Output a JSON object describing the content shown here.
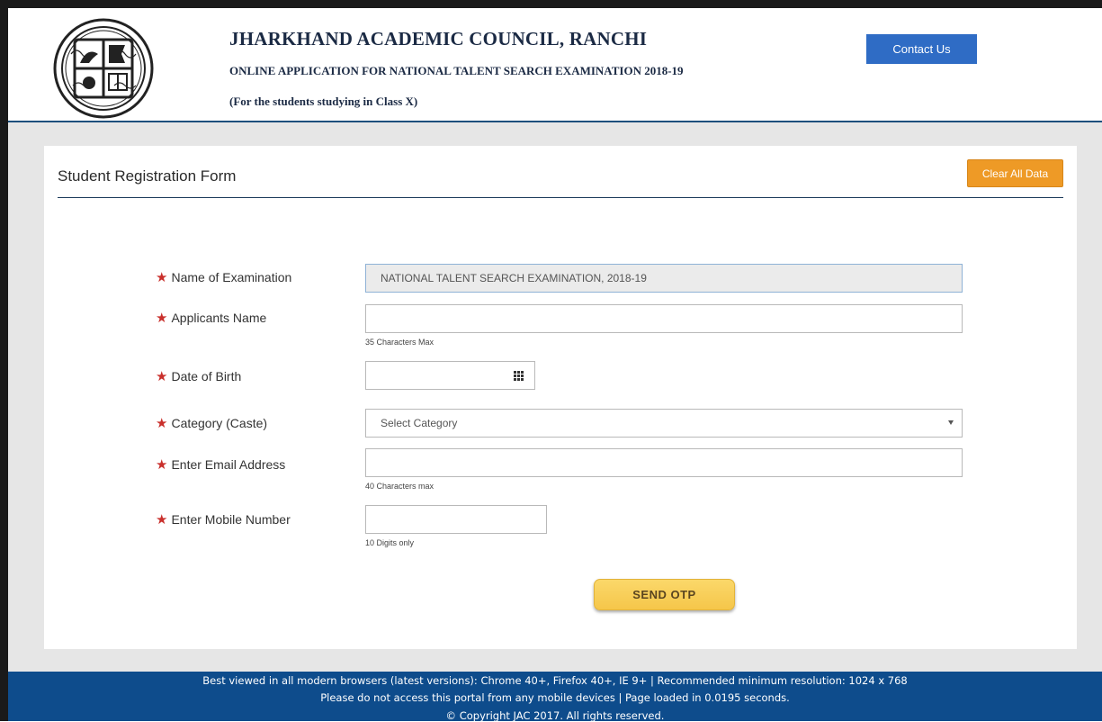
{
  "header": {
    "title": "JHARKHAND ACADEMIC COUNCIL, RANCHI",
    "subtitle": "ONLINE APPLICATION FOR NATIONAL TALENT SEARCH EXAMINATION 2018-19",
    "subtitle2": "(For the students studying in Class X)",
    "contact_label": "Contact Us",
    "logo_icon": "jac-emblem-icon"
  },
  "form": {
    "title": "Student Registration Form",
    "clear_label": "Clear All Data",
    "required_mark": "★",
    "fields": {
      "exam": {
        "label": "Name of Examination",
        "value": "NATIONAL TALENT SEARCH EXAMINATION, 2018-19"
      },
      "name": {
        "label": "Applicants Name",
        "value": "",
        "hint": "35 Characters Max"
      },
      "dob": {
        "label": "Date of Birth",
        "value": "",
        "icon": "calendar-icon"
      },
      "category": {
        "label": "Category (Caste)",
        "selected": "Select Category"
      },
      "email": {
        "label": "Enter Email Address",
        "value": "",
        "hint": "40 Characters max"
      },
      "mobile": {
        "label": "Enter Mobile Number",
        "value": "",
        "hint": "10 Digits only"
      }
    },
    "send_otp_label": "SEND OTP"
  },
  "footer": {
    "line1": "Best viewed in all modern browsers (latest versions): Chrome 40+, Firefox 40+, IE 9+ | Recommended minimum resolution: 1024 x 768",
    "line2": "Please do not access this portal from any mobile devices | Page loaded in 0.0195 seconds.",
    "line3": "© Copyright JAC 2017. All rights reserved."
  },
  "colors": {
    "header_rule": "#1e4f7d",
    "contact_button": "#2f6cc5",
    "clear_button": "#ee9a26",
    "otp_button": "#f5c64a",
    "footer_bg": "#0e4c8c",
    "required_star": "#c9302c"
  }
}
